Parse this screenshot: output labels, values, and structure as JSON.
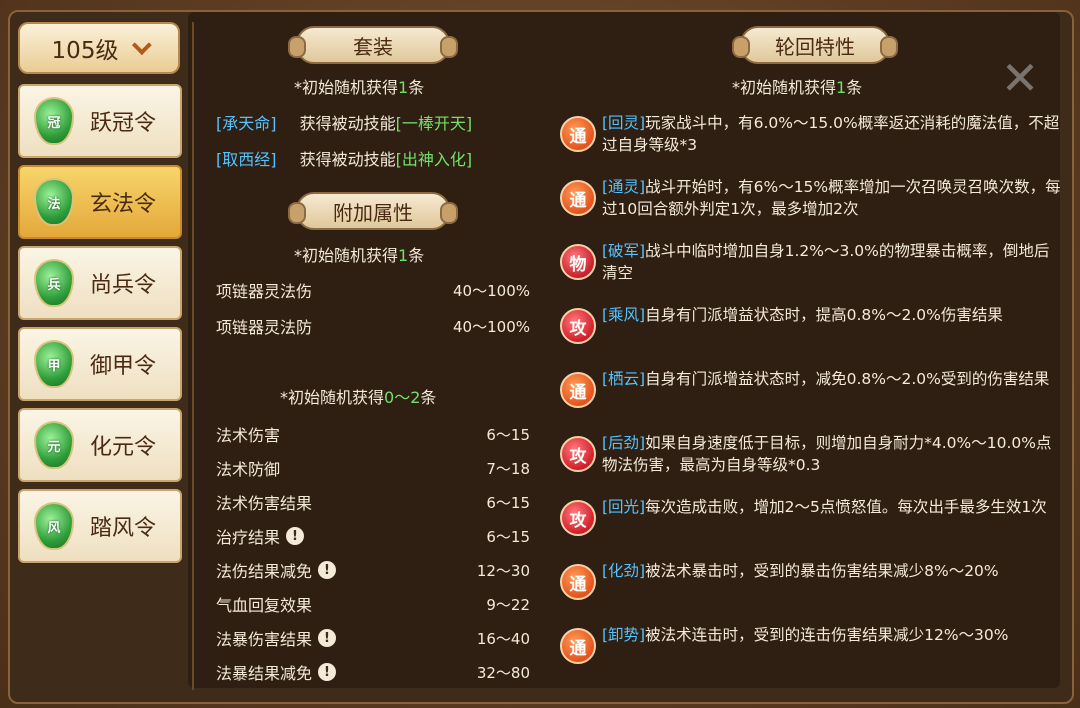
{
  "level_select": {
    "label": "105级"
  },
  "tokens": [
    {
      "label": "跃冠令",
      "glyph": "冠",
      "active": false
    },
    {
      "label": "玄法令",
      "glyph": "法",
      "active": true
    },
    {
      "label": "尚兵令",
      "glyph": "兵",
      "active": false
    },
    {
      "label": "御甲令",
      "glyph": "甲",
      "active": false
    },
    {
      "label": "化元令",
      "glyph": "元",
      "active": false
    },
    {
      "label": "踏风令",
      "glyph": "风",
      "active": false
    }
  ],
  "set_section": {
    "title": "套装",
    "note_prefix": "*初始随机获得",
    "note_count": "1",
    "note_suffix": "条",
    "items": [
      {
        "tag": "[承天命]",
        "text": "获得被动技能",
        "skill": "[一棒开天]"
      },
      {
        "tag": "[取西经]",
        "text": "获得被动技能",
        "skill": "[出神入化]"
      }
    ]
  },
  "extra_section": {
    "title": "附加属性",
    "note_prefix": "*初始随机获得",
    "note_count": "1",
    "note_suffix": "条",
    "items": [
      {
        "name": "项链器灵法伤",
        "value": "40～100%",
        "warn": false
      },
      {
        "name": "项链器灵法防",
        "value": "40～100%",
        "warn": false
      }
    ],
    "note2_prefix": "*初始随机获得",
    "note2_count": "0～2",
    "note2_suffix": "条",
    "items2": [
      {
        "name": "法术伤害",
        "value": "6～15",
        "warn": false
      },
      {
        "name": "法术防御",
        "value": "7～18",
        "warn": false
      },
      {
        "name": "法术伤害结果",
        "value": "6～15",
        "warn": false
      },
      {
        "name": "治疗结果",
        "value": "6～15",
        "warn": true
      },
      {
        "name": "法伤结果减免",
        "value": "12～30",
        "warn": true
      },
      {
        "name": "气血回复效果",
        "value": "9～22",
        "warn": false
      },
      {
        "name": "法暴伤害结果",
        "value": "16～40",
        "warn": true
      },
      {
        "name": "法暴结果减免",
        "value": "32～80",
        "warn": true
      }
    ]
  },
  "reincarnation": {
    "title": "轮回特性",
    "note_prefix": "*初始随机获得",
    "note_count": "1",
    "note_suffix": "条",
    "traits": [
      {
        "badge": "通",
        "kind": "tong",
        "tag": "[回灵]",
        "text": "玩家战斗中，有6.0%～15.0%概率返还消耗的魔法值，不超过自身等级*3"
      },
      {
        "badge": "通",
        "kind": "tong",
        "tag": "[通灵]",
        "text": "战斗开始时，有6%～15%概率增加一次召唤灵召唤次数，每过10回合额外判定1次，最多增加2次"
      },
      {
        "badge": "物",
        "kind": "phys",
        "tag": "[破军]",
        "text": "战斗中临时增加自身1.2%～3.0%的物理暴击概率，倒地后清空"
      },
      {
        "badge": "攻",
        "kind": "atk",
        "tag": "[乘风]",
        "text": "自身有门派增益状态时，提高0.8%～2.0%伤害结果"
      },
      {
        "badge": "通",
        "kind": "tong",
        "tag": "[栖云]",
        "text": "自身有门派增益状态时，减免0.8%～2.0%受到的伤害结果"
      },
      {
        "badge": "攻",
        "kind": "atk",
        "tag": "[后劲]",
        "text": "如果自身速度低于目标，则增加自身耐力*4.0%～10.0%点物法伤害，最高为自身等级*0.3"
      },
      {
        "badge": "攻",
        "kind": "atk",
        "tag": "[回光]",
        "text": "每次造成击败，增加2～5点愤怒值。每次出手最多生效1次"
      },
      {
        "badge": "通",
        "kind": "tong",
        "tag": "[化劲]",
        "text": "被法术暴击时，受到的暴击伤害结果减少8%～20%"
      },
      {
        "badge": "通",
        "kind": "tong",
        "tag": "[卸势]",
        "text": "被法术连击时，受到的连击伤害结果减少12%～30%"
      }
    ]
  },
  "close_glyph": "✕"
}
